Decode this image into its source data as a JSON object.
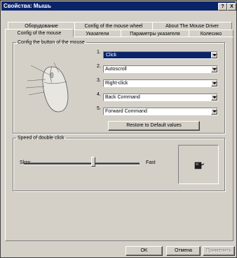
{
  "window": {
    "title": "Свойства: Мышь",
    "help_button": "?",
    "close_button": "X"
  },
  "tabs_row1": [
    {
      "label": "Оборудование"
    },
    {
      "label": "Config of the mouse wheel"
    },
    {
      "label": "About The Mouse Driver"
    }
  ],
  "tabs_row2": [
    {
      "label": "Config of the mouse",
      "active": true
    },
    {
      "label": "Указатели"
    },
    {
      "label": "Параметры указателя"
    },
    {
      "label": "Колесико"
    }
  ],
  "buttons_group": {
    "legend": "Config the button of the mouse",
    "assignments": [
      {
        "num": "1.",
        "value": "Click",
        "selected": true
      },
      {
        "num": "2.",
        "value": "Autoscroll"
      },
      {
        "num": "3.",
        "value": "Right-click"
      },
      {
        "num": "4.",
        "value": "Back Command"
      },
      {
        "num": "5.",
        "value": "Forward Command"
      }
    ],
    "restore_label": "Restore to Default values"
  },
  "double_click_group": {
    "legend": "Speed of double click",
    "slow_label": "Slow",
    "fast_label": "Fast",
    "speed_fraction": 0.6
  },
  "footer": {
    "ok_label": "OK",
    "cancel_label": "Отмена",
    "apply_label": "Применить"
  },
  "colors": {
    "titlebar": "#0a246a",
    "face": "#d4d0c8",
    "selection": "#0a246a"
  },
  "icons": [
    "mouse-illustration-icon",
    "test-mouse-icon",
    "dropdown-arrow-icon"
  ]
}
